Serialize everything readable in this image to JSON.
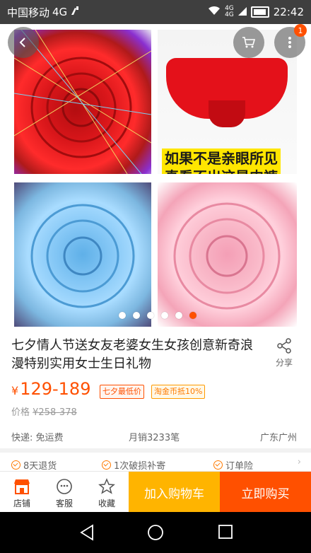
{
  "status_bar": {
    "carrier": "中国移动",
    "network": "4G",
    "lte_top": "4G",
    "lte_bottom": "4G",
    "time": "22:42"
  },
  "hero": {
    "image_text_line1": "如果不是亲眼所见",
    "image_text_line2": "真看不出这是内裤",
    "cart_badge": "1",
    "carousel_total": 6,
    "carousel_active": 6
  },
  "product": {
    "title": "七夕情人节送女友老婆女生女孩创意新奇浪漫特别实用女士生日礼物",
    "share_label": "分享",
    "currency": "¥",
    "price_range": "129-189",
    "tag_lowest": "七夕最低价",
    "tag_coin": "淘金币抵10%",
    "orig_label": "价格",
    "orig_price": "¥258-378"
  },
  "meta": {
    "shipping": "快递: 免运费",
    "monthly_sales": "月销3233笔",
    "location": "广东广州"
  },
  "promise": {
    "items": [
      "8天退货",
      "1次破损补寄",
      "订单险"
    ]
  },
  "bottom_bar": {
    "shop_label": "店铺",
    "service_label": "客服",
    "favorite_label": "收藏",
    "add_to_cart": "加入购物车",
    "buy_now": "立即购买"
  },
  "colors": {
    "accent": "#ff5000",
    "cart_button": "#ffb400"
  }
}
